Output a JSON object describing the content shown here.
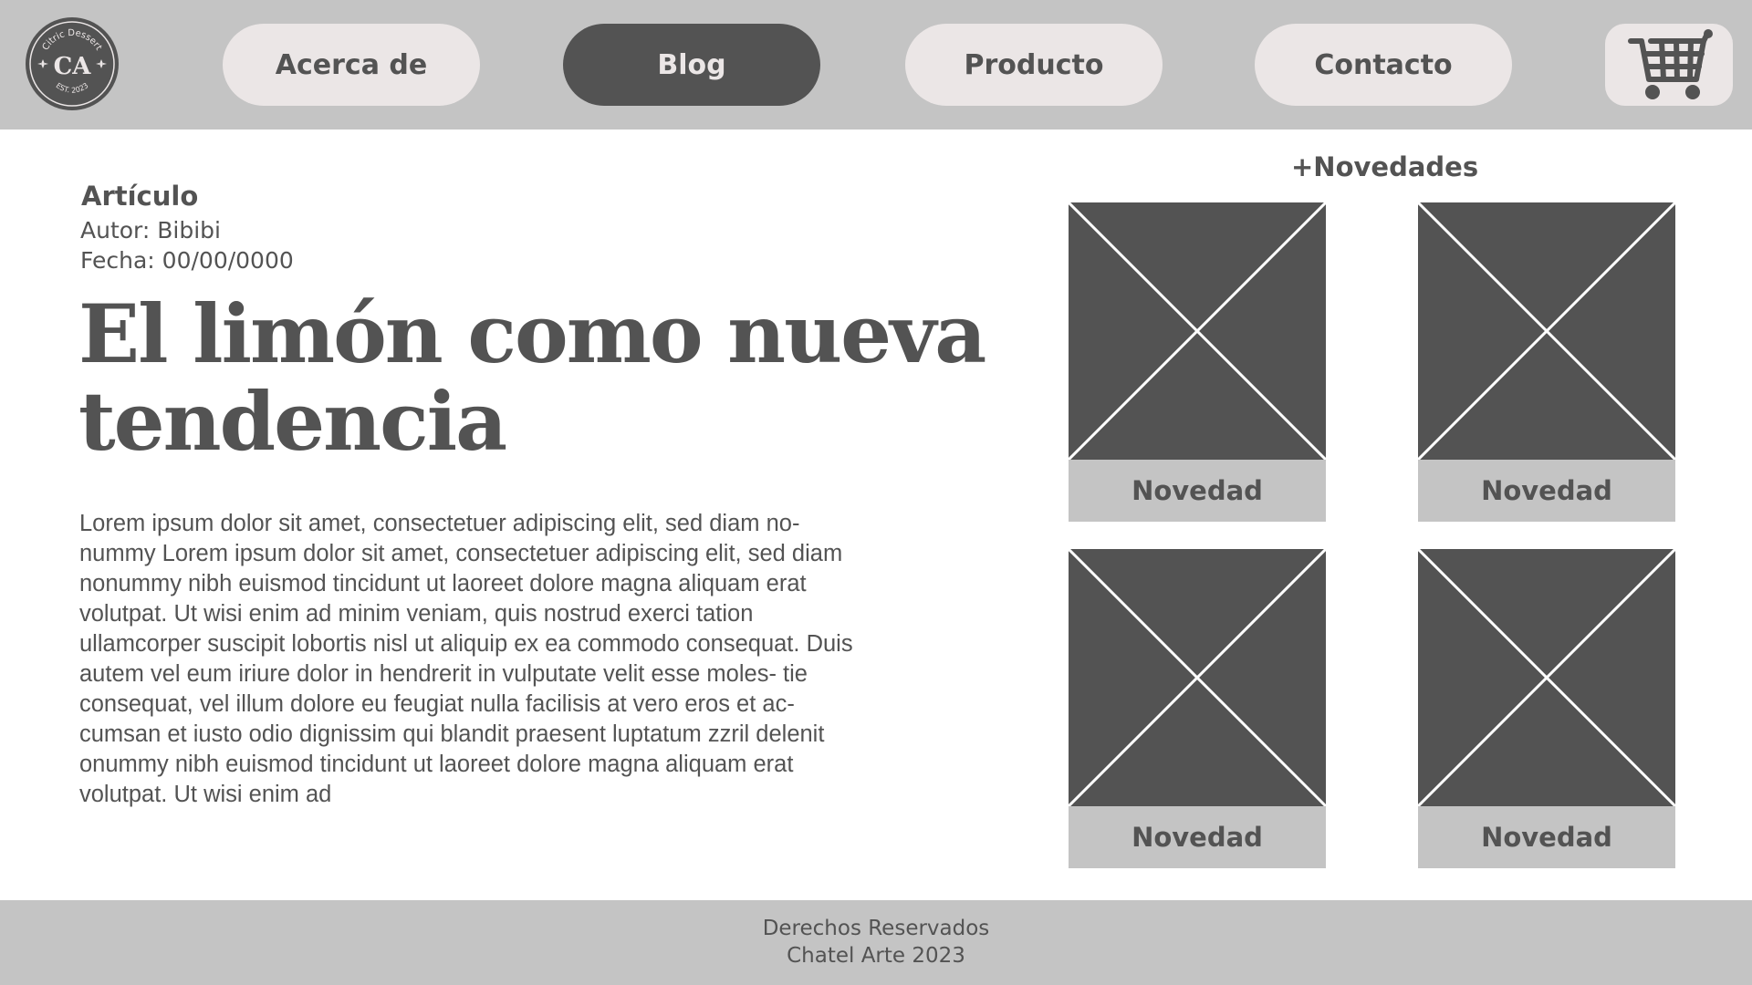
{
  "brand": {
    "logo_text": "Citric Dessert",
    "logo_monogram": "CA",
    "logo_est": "EST. 2023"
  },
  "nav": {
    "items": [
      {
        "label": "Acerca de",
        "active": false
      },
      {
        "label": "Blog",
        "active": true
      },
      {
        "label": "Producto",
        "active": false
      },
      {
        "label": "Contacto",
        "active": false
      }
    ],
    "cart_icon": "shopping-cart-icon"
  },
  "article": {
    "section": "Artículo",
    "author": "Autor: Bibibi",
    "date": "Fecha: 00/00/0000",
    "headline_line1": "El limón como nueva",
    "headline_line2": "tendencia",
    "body": "Lorem ipsum dolor sit amet, consectetuer adipiscing elit, sed diam no- nummy Lorem ipsum dolor sit amet, consectetuer adipiscing elit, sed diam nonummy nibh euismod tincidunt ut laoreet dolore magna aliquam erat volutpat. Ut wisi enim ad minim veniam, quis nostrud exerci tation ullamcorper suscipit lobortis nisl ut aliquip ex ea commodo consequat. Duis autem vel eum iriure dolor in hendrerit in vulputate velit esse moles- tie consequat, vel illum dolore eu feugiat nulla facilisis at vero eros et ac- cumsan et iusto odio dignissim qui blandit praesent luptatum zzril delenit onummy nibh euismod tincidunt ut laoreet dolore magna aliquam erat volutpat. Ut wisi enim ad"
  },
  "news": {
    "title": "+Novedades",
    "items": [
      {
        "caption": "Novedad",
        "image_icon": "image-placeholder-icon"
      },
      {
        "caption": "Novedad",
        "image_icon": "image-placeholder-icon"
      },
      {
        "caption": "Novedad",
        "image_icon": "image-placeholder-icon"
      },
      {
        "caption": "Novedad",
        "image_icon": "image-placeholder-icon"
      }
    ]
  },
  "footer": {
    "line1": "Derechos Reservados",
    "line2": "Chatel Arte 2023"
  },
  "colors": {
    "header_bg": "#c4c4c4",
    "dark": "#535353",
    "light_button": "#ebe6e6",
    "background": "#ffffff"
  }
}
